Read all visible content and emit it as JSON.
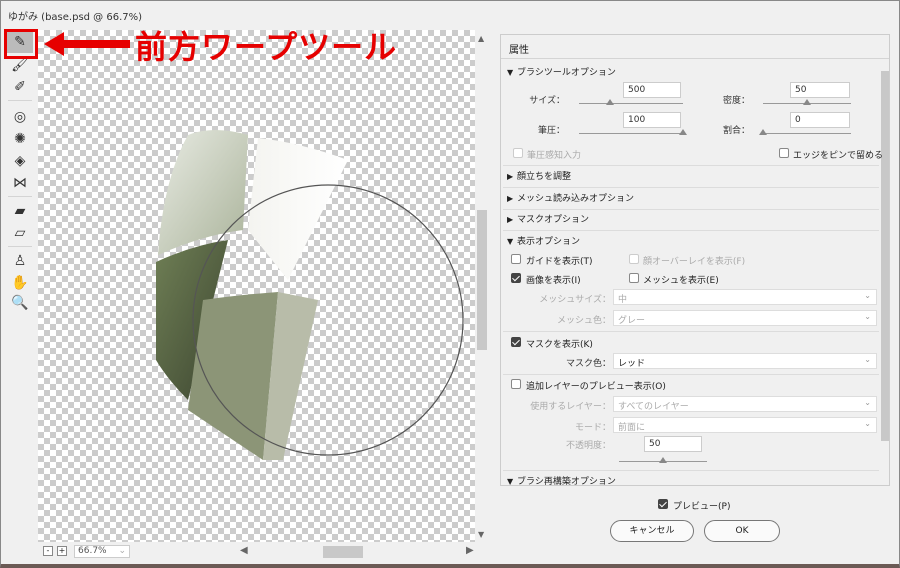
{
  "window": {
    "title": "ゆがみ (base.psd @ 66.7%)"
  },
  "annotation": {
    "text": "前方ワープツール",
    "color": "#e60000"
  },
  "tools": [
    {
      "name": "forward-warp-tool",
      "icon": "warp-icon",
      "selected": true
    },
    {
      "name": "reconstruct-tool",
      "icon": "reconstruct-brush-icon"
    },
    {
      "name": "smooth-tool",
      "icon": "smooth-brush-icon"
    },
    {
      "name": "twirl-tool",
      "icon": "twirl-icon"
    },
    {
      "name": "pucker-tool",
      "icon": "pucker-icon"
    },
    {
      "name": "bloat-tool",
      "icon": "bloat-icon"
    },
    {
      "name": "push-left-tool",
      "icon": "push-left-icon"
    },
    {
      "name": "freeze-mask-tool",
      "icon": "freeze-mask-icon"
    },
    {
      "name": "thaw-mask-tool",
      "icon": "thaw-mask-icon"
    },
    {
      "name": "face-tool",
      "icon": "face-icon"
    },
    {
      "name": "hand-tool",
      "icon": "hand-icon"
    },
    {
      "name": "zoom-tool",
      "icon": "magnifier-icon"
    }
  ],
  "canvas": {
    "zoom": "66.7%"
  },
  "panel": {
    "title": "属性",
    "brush_options": {
      "label": "ブラシツールオプション",
      "size_label": "サイズ：",
      "size": "500",
      "size_pct": 0.3,
      "density_label": "密度：",
      "density": "50",
      "density_pct": 0.5,
      "pressure_label": "筆圧：",
      "pressure": "100",
      "pressure_pct": 1.0,
      "rate_label": "割合：",
      "rate": "0",
      "rate_pct": 0,
      "stylus_label": "筆圧感知入力",
      "pin_edges_label": "エッジをピンで留める"
    },
    "face_label": "顔立ちを調整",
    "mesh_load_label": "メッシュ読み込みオプション",
    "mask_options_label": "マスクオプション",
    "view_options": {
      "label": "表示オプション",
      "guides": "ガイドを表示(T)",
      "face_overlay": "顔オーバーレイを表示(F)",
      "image": "画像を表示(I)",
      "mesh": "メッシュを表示(E)",
      "mesh_size_label": "メッシュサイズ：",
      "mesh_size": "中",
      "mesh_color_label": "メッシュ色：",
      "mesh_color": "グレー",
      "show_mask": "マスクを表示(K)",
      "mask_color_label": "マスク色：",
      "mask_color": "レッド",
      "backdrop": "追加レイヤーのプレビュー表示(O)",
      "use_layer_label": "使用するレイヤー：",
      "use_layer": "すべてのレイヤー",
      "mode_label": "モード：",
      "mode": "前面に",
      "opacity_label": "不透明度：",
      "opacity": "50",
      "opacity_pct": 0.5
    },
    "brush_reconstruct_label": "ブラシ再構築オプション"
  },
  "footer": {
    "preview": "プレビュー(P)",
    "cancel": "キャンセル",
    "ok": "OK"
  }
}
